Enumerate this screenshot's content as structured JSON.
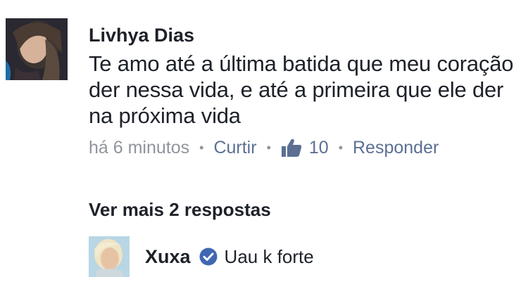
{
  "comment": {
    "author": "Livhya Dias",
    "text": "Te amo até a última batida que meu coração der nessa vida, e até a primeira que ele der na próxima vida",
    "time": "há 6 minutos",
    "separator": "•",
    "like_label": "Curtir",
    "like_count": "10",
    "reply_label": "Responder"
  },
  "replies": {
    "more_label": "Ver mais 2 respostas",
    "items": [
      {
        "author": "Xuxa",
        "verified": true,
        "text": "Uau k forte"
      }
    ]
  },
  "icons": {
    "like": "thumbs-up-icon",
    "verified": "verified-badge-icon"
  },
  "colors": {
    "link": "#5c6f93",
    "meta": "#90949c",
    "verified": "#4267b2",
    "text": "#1d2129"
  }
}
